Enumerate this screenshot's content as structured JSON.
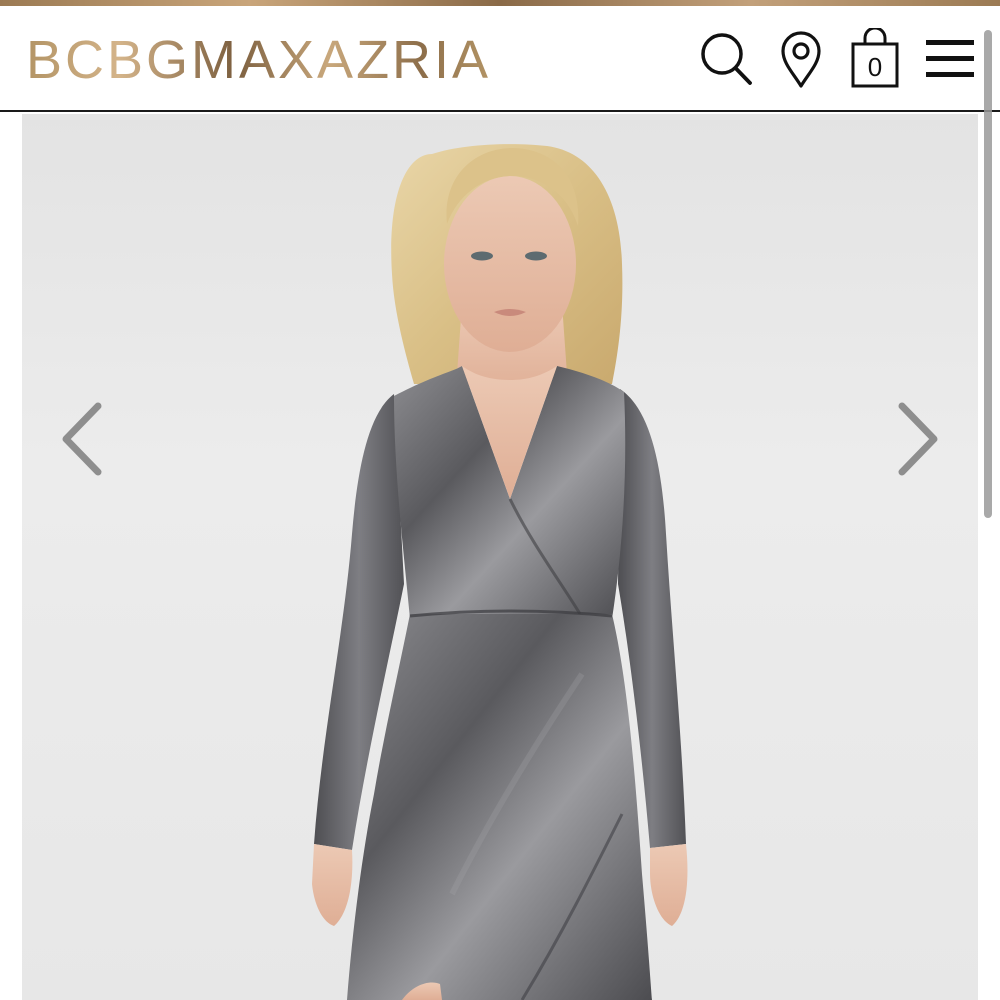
{
  "header": {
    "brand": "BCBGMAXAZRIA",
    "bag_count": "0"
  },
  "icons": {
    "search": "search-icon",
    "location": "map-pin-icon",
    "bag": "shopping-bag-icon",
    "menu": "hamburger-menu-icon",
    "prev": "chevron-left-icon",
    "next": "chevron-right-icon"
  },
  "product_image": {
    "description_visible": false,
    "image_index": 1
  },
  "colors": {
    "brand_gold": "#a3875f",
    "header_border": "#1a1a1a",
    "hero_bg": "#e8e8e8",
    "dress_metallic": "#6b6b6e",
    "arrow": "#8e8e8e"
  }
}
